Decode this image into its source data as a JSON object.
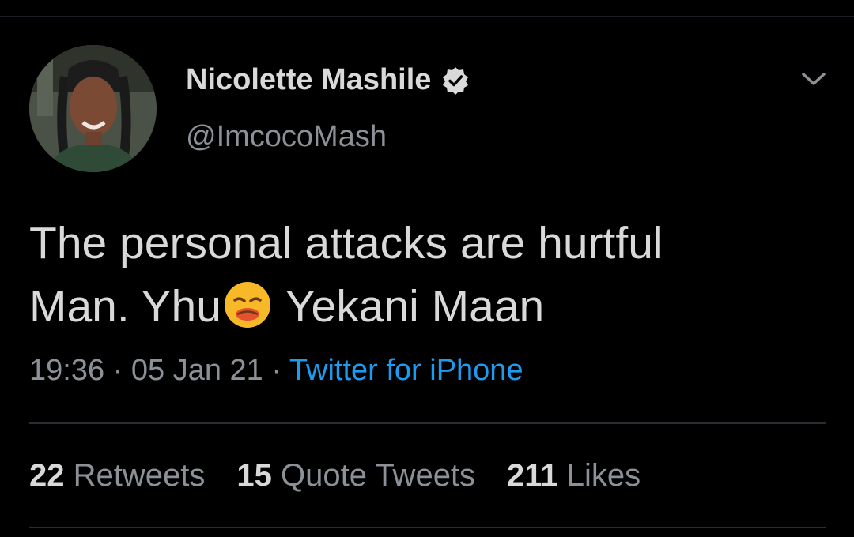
{
  "tweet": {
    "author": {
      "display_name": "Nicolette Mashile",
      "handle": "@ImcocoMash",
      "verified": true,
      "avatar_icon": "profile-photo"
    },
    "text_line1": "The personal attacks are hurtful",
    "text_line2_before": "Man. Yhu",
    "text_line2_emoji": "anguished-face-emoji",
    "text_line2_after": " Yekani Maan",
    "time": "19:36",
    "separator": " · ",
    "date": "05 Jan 21",
    "source": "Twitter for iPhone",
    "stats": {
      "retweets_count": "22",
      "retweets_label": " Retweets",
      "quotes_count": "15",
      "quotes_label": " Quote Tweets",
      "likes_count": "211",
      "likes_label": " Likes"
    },
    "menu_icon": "chevron-down-icon"
  },
  "colors": {
    "background": "#000000",
    "primary_text": "#d9d9d9",
    "secondary_text": "#8b9197",
    "link": "#1d9bf0",
    "divider": "#2a2e33"
  }
}
